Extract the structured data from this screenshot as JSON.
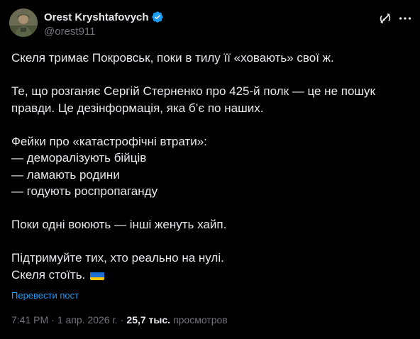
{
  "author": {
    "display_name": "Orest Kryshtafovych",
    "handle": "@orest911",
    "verified": true,
    "verified_color": "#1d9bf0"
  },
  "header_icons": {
    "grok": "grok-icon",
    "more": "more-icon"
  },
  "tweet": {
    "paragraphs": [
      [
        "Скеля тримає Покровськ, поки в тилу її «ховають» свої ж."
      ],
      [
        "Те, що розганяє Сергій Стерненко про 425-й полк — це не пошук",
        "правди. Це дезінформація, яка б’є по наших."
      ],
      [
        "Фейки про «катастрофічні втрати»:",
        "— деморалізують бійців",
        "— ламають родини",
        "— годують роспропаганду"
      ],
      [
        "Поки одні воюють — інші женуть хайп."
      ],
      [
        "Підтримуйте тих, хто реально на нулі.",
        "Скеля стоїть."
      ]
    ],
    "flag": "ukraine-flag-emoji"
  },
  "translate_label": "Перевести пост",
  "meta": {
    "time": "7:41 PM",
    "separator": "·",
    "date": "1 апр. 2026 г.",
    "views_count": "25,7 тыс.",
    "views_label": "просмотров"
  },
  "colors": {
    "background": "#000000",
    "text": "#e7e9ea",
    "secondary": "#71767b",
    "link": "#1d9bf0"
  }
}
